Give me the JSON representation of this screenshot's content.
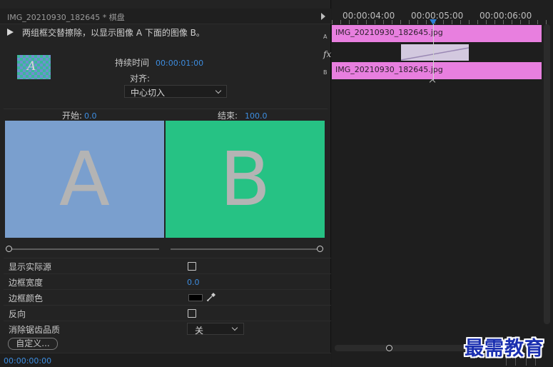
{
  "panel": {
    "title": "IMG_20210930_182645 * 棋盘",
    "description": "两组框交替擦除，以显示图像 A 下面的图像 B。"
  },
  "transition": {
    "duration_label": "持续时间",
    "duration_value": "00:00:01:00",
    "align_label": "对齐:",
    "align_value": "中心切入",
    "start_label": "开始:",
    "start_value": "0.0",
    "end_label": "结束:",
    "end_value": "100.0",
    "preview_a_letter": "A",
    "preview_b_letter": "B",
    "thumb_glyph": "A"
  },
  "properties": {
    "show_actual_sources": "显示实际源",
    "show_actual_sources_checked": false,
    "border_width_label": "边框宽度",
    "border_width_value": "0.0",
    "border_color_label": "边框颜色",
    "border_color_value": "#000000",
    "reverse_label": "反向",
    "reverse_checked": false,
    "antialias_label": "消除锯齿品质",
    "antialias_value": "关"
  },
  "footer": {
    "custom_button": "自定义...",
    "timecode": "00:00:00:00"
  },
  "timeline": {
    "ruler_labels": [
      "00:00:04:00",
      "00:00:05:00",
      "00:00:06:00"
    ],
    "track_a_letter": "A",
    "track_b_letter": "B",
    "fx_label": "fx",
    "clip_a_name": "IMG_20210930_182645.jpg",
    "clip_b_name": "IMG_20210930_182645.jpg"
  },
  "colors": {
    "accent": "#3d8de0",
    "clip": "#e87fdf",
    "preview_a": "#7a9fce",
    "preview_b": "#26c284"
  },
  "watermark": "最需教育"
}
